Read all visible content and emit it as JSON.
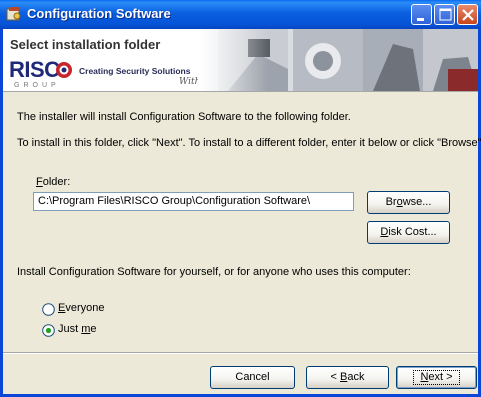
{
  "window": {
    "title": "Configuration Software"
  },
  "banner": {
    "heading": "Select installation folder",
    "logo_text": "RISC",
    "logo_sub": "GROUP",
    "slogan": "Creating Security Solutions",
    "slogan_tail": "With Care."
  },
  "body": {
    "intro": "The installer will install Configuration Software to the following folder.",
    "instructions": "To install in this folder, click \"Next\". To install to a different folder, enter it below or click \"Browse\".",
    "folder_label_prefix": "",
    "folder_label_hotkey": "F",
    "folder_label_rest": "older:",
    "folder_value": "C:\\Program Files\\RISCO Group\\Configuration Software\\",
    "install_for": "Install Configuration Software for yourself, or for anyone who uses this computer:"
  },
  "buttons": {
    "browse_pre": "Br",
    "browse_hotkey": "o",
    "browse_post": "wse...",
    "diskcost_hotkey": "D",
    "diskcost_post": "isk Cost...",
    "cancel": "Cancel",
    "back_pre": "< ",
    "back_hotkey": "B",
    "back_post": "ack",
    "next_hotkey": "N",
    "next_post": "ext >"
  },
  "options": {
    "everyone_hotkey": "E",
    "everyone_rest": "veryone",
    "justme_pre": "Just ",
    "justme_hotkey": "m",
    "justme_post": "e",
    "selected": "Just me"
  }
}
